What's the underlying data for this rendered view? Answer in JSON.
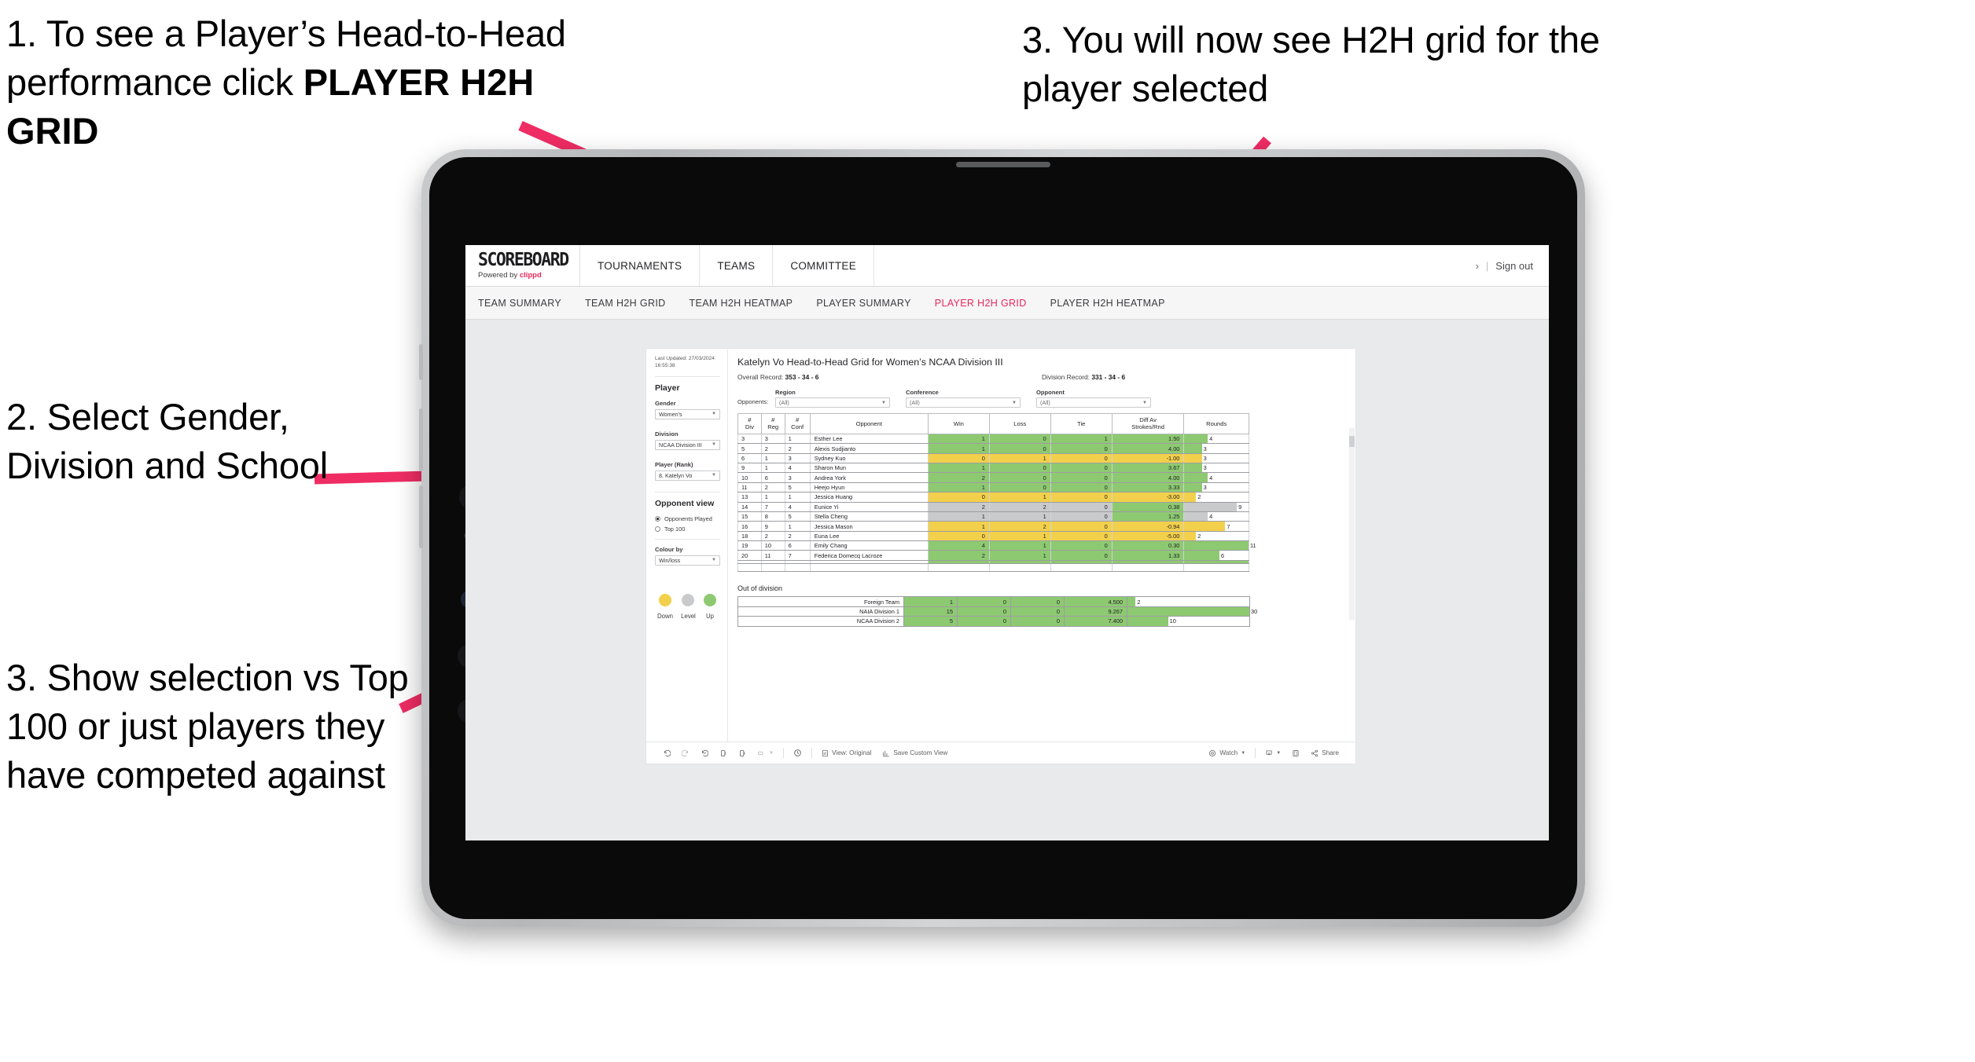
{
  "annotations": [
    {
      "id": "a1",
      "text_plain": "1. To see a Player’s Head-to-Head performance click ",
      "emphasis": "PLAYER H2H GRID"
    },
    {
      "id": "a2",
      "text_plain": "2. Select Gender, Division and School",
      "emphasis": ""
    },
    {
      "id": "a3",
      "text_plain": "3. Show selection vs Top 100 or just players they have competed against",
      "emphasis": ""
    },
    {
      "id": "a4",
      "text_plain": "3. You will now see H2H grid for the player selected",
      "emphasis": ""
    }
  ],
  "colors": {
    "accent_pink": "#e8275a",
    "arrow_pink": "#ef2d64",
    "up_green": "#8dc971",
    "down_yellow": "#f2d04b",
    "level_grey": "#c9cacc",
    "device_bezel": "#0a0a0a",
    "device_frame": "#c9cacc"
  },
  "app": {
    "brand": {
      "name": "SCOREBOARD",
      "tagline_prefix": "Powered by ",
      "tagline_brand": "clippd"
    },
    "top_nav": [
      "TOURNAMENTS",
      "TEAMS",
      "COMMITTEE"
    ],
    "account": {
      "chevron": "›",
      "separator": "|",
      "sign_out": "Sign out"
    },
    "tabs": [
      {
        "label": "TEAM SUMMARY",
        "active": false
      },
      {
        "label": "TEAM H2H GRID",
        "active": false
      },
      {
        "label": "TEAM H2H HEATMAP",
        "active": false
      },
      {
        "label": "PLAYER SUMMARY",
        "active": false
      },
      {
        "label": "PLAYER H2H GRID",
        "active": true
      },
      {
        "label": "PLAYER H2H HEATMAP",
        "active": false
      }
    ]
  },
  "sidebar": {
    "last_updated": "Last Updated: 27/03/2024 16:55:38",
    "section_player": "Player",
    "filters": [
      {
        "label": "Gender",
        "value": "Women's"
      },
      {
        "label": "Division",
        "value": "NCAA Division III"
      },
      {
        "label": "Player (Rank)",
        "value": "8. Katelyn Vo"
      }
    ],
    "opponent_view": {
      "title": "Opponent view",
      "options": [
        {
          "label": "Opponents Played",
          "selected": true
        },
        {
          "label": "Top 100",
          "selected": false
        }
      ]
    },
    "colour_by": {
      "label": "Colour by",
      "value": "Win/loss"
    },
    "legend": [
      {
        "label": "Down",
        "color": "#f2d04b"
      },
      {
        "label": "Level",
        "color": "#c9cacc"
      },
      {
        "label": "Up",
        "color": "#8dc971"
      }
    ]
  },
  "viz": {
    "title": "Katelyn Vo Head-to-Head Grid for Women’s NCAA Division III",
    "overall_record_label": "Overall Record:",
    "overall_record_value": "353 - 34 - 6",
    "division_record_label": "Division Record:",
    "division_record_value": "331 - 34 - 6",
    "opponents_label": "Opponents:",
    "opponent_filters": [
      {
        "label": "Region",
        "value": "(All)"
      },
      {
        "label": "Conference",
        "value": "(All)"
      },
      {
        "label": "Opponent",
        "value": "(All)"
      }
    ],
    "out_of_division_title": "Out of division"
  },
  "chart_data": {
    "type": "table",
    "title": "Katelyn Vo Head-to-Head Grid for Women’s NCAA Division III",
    "columns": [
      "# Div",
      "# Reg",
      "# Conf",
      "Opponent",
      "Win",
      "Loss",
      "Tie",
      "Diff Av Strokes/Rnd",
      "Rounds"
    ],
    "column_headers_two_line": [
      {
        "l1": "#",
        "l2": "Div"
      },
      {
        "l1": "#",
        "l2": "Reg"
      },
      {
        "l1": "#",
        "l2": "Conf"
      },
      {
        "l1": "Opponent",
        "l2": ""
      },
      {
        "l1": "Win",
        "l2": ""
      },
      {
        "l1": "Loss",
        "l2": ""
      },
      {
        "l1": "Tie",
        "l2": ""
      },
      {
        "l1": "Diff Av",
        "l2": "Strokes/Rnd"
      },
      {
        "l1": "Rounds",
        "l2": ""
      }
    ],
    "rounds_max": 11,
    "rows": [
      {
        "div": "3",
        "reg": "3",
        "conf": "1",
        "opponent": "Esther Lee",
        "win": "1",
        "loss": "0",
        "tie": "1",
        "diff": "1.50",
        "rounds": "4",
        "rounds_n": 4,
        "state": "up"
      },
      {
        "div": "5",
        "reg": "2",
        "conf": "2",
        "opponent": "Alexis Sudjianto",
        "win": "1",
        "loss": "0",
        "tie": "0",
        "diff": "4.00",
        "rounds": "3",
        "rounds_n": 3,
        "state": "up"
      },
      {
        "div": "6",
        "reg": "1",
        "conf": "3",
        "opponent": "Sydney Kuo",
        "win": "0",
        "loss": "1",
        "tie": "0",
        "diff": "-1.00",
        "rounds": "3",
        "rounds_n": 3,
        "state": "down"
      },
      {
        "div": "9",
        "reg": "1",
        "conf": "4",
        "opponent": "Sharon Mun",
        "win": "1",
        "loss": "0",
        "tie": "0",
        "diff": "3.67",
        "rounds": "3",
        "rounds_n": 3,
        "state": "up"
      },
      {
        "div": "10",
        "reg": "6",
        "conf": "3",
        "opponent": "Andrea York",
        "win": "2",
        "loss": "0",
        "tie": "0",
        "diff": "4.00",
        "rounds": "4",
        "rounds_n": 4,
        "state": "up"
      },
      {
        "div": "11",
        "reg": "2",
        "conf": "5",
        "opponent": "Heejo Hyun",
        "win": "1",
        "loss": "0",
        "tie": "0",
        "diff": "3.33",
        "rounds": "3",
        "rounds_n": 3,
        "state": "up"
      },
      {
        "div": "13",
        "reg": "1",
        "conf": "1",
        "opponent": "Jessica Huang",
        "win": "0",
        "loss": "1",
        "tie": "0",
        "diff": "-3.00",
        "rounds": "2",
        "rounds_n": 2,
        "state": "down"
      },
      {
        "div": "14",
        "reg": "7",
        "conf": "4",
        "opponent": "Eunice Yi",
        "win": "2",
        "loss": "2",
        "tie": "0",
        "diff": "0.38",
        "rounds": "9",
        "rounds_n": 9,
        "state": "level",
        "diff_state": "up"
      },
      {
        "div": "15",
        "reg": "8",
        "conf": "5",
        "opponent": "Stella Cheng",
        "win": "1",
        "loss": "1",
        "tie": "0",
        "diff": "1.25",
        "rounds": "4",
        "rounds_n": 4,
        "state": "level",
        "diff_state": "up"
      },
      {
        "div": "16",
        "reg": "9",
        "conf": "1",
        "opponent": "Jessica Mason",
        "win": "1",
        "loss": "2",
        "tie": "0",
        "diff": "-0.94",
        "rounds": "7",
        "rounds_n": 7,
        "state": "down"
      },
      {
        "div": "18",
        "reg": "2",
        "conf": "2",
        "opponent": "Euna Lee",
        "win": "0",
        "loss": "1",
        "tie": "0",
        "diff": "-5.00",
        "rounds": "2",
        "rounds_n": 2,
        "state": "down"
      },
      {
        "div": "19",
        "reg": "10",
        "conf": "6",
        "opponent": "Emily Chang",
        "win": "4",
        "loss": "1",
        "tie": "0",
        "diff": "0.30",
        "rounds": "11",
        "rounds_n": 11,
        "state": "up"
      },
      {
        "div": "20",
        "reg": "11",
        "conf": "7",
        "opponent": "Federica Domecq Lacroze",
        "win": "2",
        "loss": "1",
        "tie": "0",
        "diff": "1.33",
        "rounds": "6",
        "rounds_n": 6,
        "state": "up"
      }
    ],
    "out_of_division": {
      "title": "Out of division",
      "rounds_max": 30,
      "rows": [
        {
          "label": "Foreign Team",
          "win": "1",
          "loss": "0",
          "tie": "0",
          "diff": "4.500",
          "rounds": "2",
          "rounds_n": 2,
          "state": "up"
        },
        {
          "label": "NAIA Division 1",
          "win": "15",
          "loss": "0",
          "tie": "0",
          "diff": "9.267",
          "rounds": "30",
          "rounds_n": 30,
          "state": "up"
        },
        {
          "label": "NCAA Division 2",
          "win": "5",
          "loss": "0",
          "tie": "0",
          "diff": "7.400",
          "rounds": "10",
          "rounds_n": 10,
          "state": "up"
        }
      ]
    }
  },
  "toolbar": {
    "undo": "undo-icon",
    "redo": "redo-icon",
    "revert": "revert-icon",
    "refresh": "refresh-data-icon",
    "pause": "pause-updates-icon",
    "view_original": "View: Original",
    "save_custom_view": "Save Custom View",
    "watch": "Watch",
    "share": "Share"
  }
}
